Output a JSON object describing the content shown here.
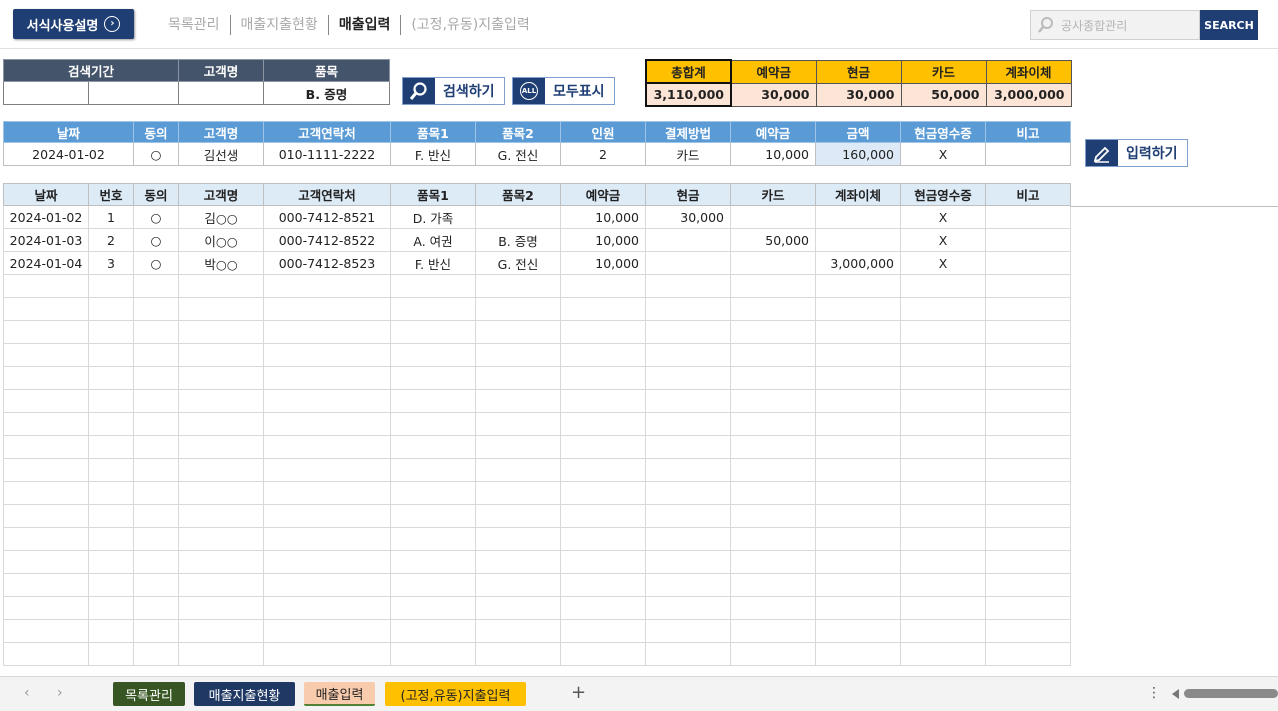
{
  "header": {
    "guide_button": "서식사용설명",
    "nav": [
      "목록관리",
      "매출지출현황",
      "매출입력",
      "(고정,유동)지출입력"
    ],
    "search_placeholder": "공사종합관리",
    "search_button": "SEARCH"
  },
  "search_filter": {
    "headers": [
      "검색기간",
      "고객명",
      "품목"
    ],
    "item_value": "B. 증명"
  },
  "buttons": {
    "search": "검색하기",
    "show_all": "모두표시",
    "show_all_icon_text": "ALL",
    "input": "입력하기"
  },
  "summary": {
    "headers": [
      "총합계",
      "예약금",
      "현금",
      "카드",
      "계좌이체"
    ],
    "values": [
      "3,110,000",
      "30,000",
      "30,000",
      "50,000",
      "3,000,000"
    ]
  },
  "input_form": {
    "headers": [
      "날짜",
      "동의",
      "고객명",
      "고객연락처",
      "품목1",
      "품목2",
      "인원",
      "결제방법",
      "예약금",
      "금액",
      "현금영수증",
      "비고"
    ],
    "row": [
      "2024-01-02",
      "○",
      "김선생",
      "010-1111-2222",
      "F. 반신",
      "G. 전신",
      "2",
      "카드",
      "10,000",
      "160,000",
      "X",
      ""
    ]
  },
  "records": {
    "headers": [
      "날짜",
      "번호",
      "동의",
      "고객명",
      "고객연락처",
      "품목1",
      "품목2",
      "예약금",
      "현금",
      "카드",
      "계좌이체",
      "현금영수증",
      "비고"
    ],
    "rows": [
      [
        "2024-01-02",
        "1",
        "○",
        "김○○",
        "000-7412-8521",
        "D. 가족",
        "",
        "10,000",
        "30,000",
        "",
        "",
        "X",
        ""
      ],
      [
        "2024-01-03",
        "2",
        "○",
        "이○○",
        "000-7412-8522",
        "A. 여권",
        "B. 증명",
        "10,000",
        "",
        "50,000",
        "",
        "X",
        ""
      ],
      [
        "2024-01-04",
        "3",
        "○",
        "박○○",
        "000-7412-8523",
        "F. 반신",
        "G. 전신",
        "10,000",
        "",
        "",
        "3,000,000",
        "X",
        ""
      ]
    ]
  },
  "sheet_tabs": [
    "목록관리",
    "매출지출현황",
    "매출입력",
    "(고정,유동)지출입력"
  ],
  "tab_bar": {
    "add": "+",
    "more": "⋮",
    "prev": "‹",
    "next": "›"
  },
  "colors": {
    "navy": "#1f3f74",
    "summary_header": "#ffc000",
    "summary_cell": "#fce4d6",
    "input_header": "#5b9bd5",
    "record_header": "#ddebf7"
  }
}
